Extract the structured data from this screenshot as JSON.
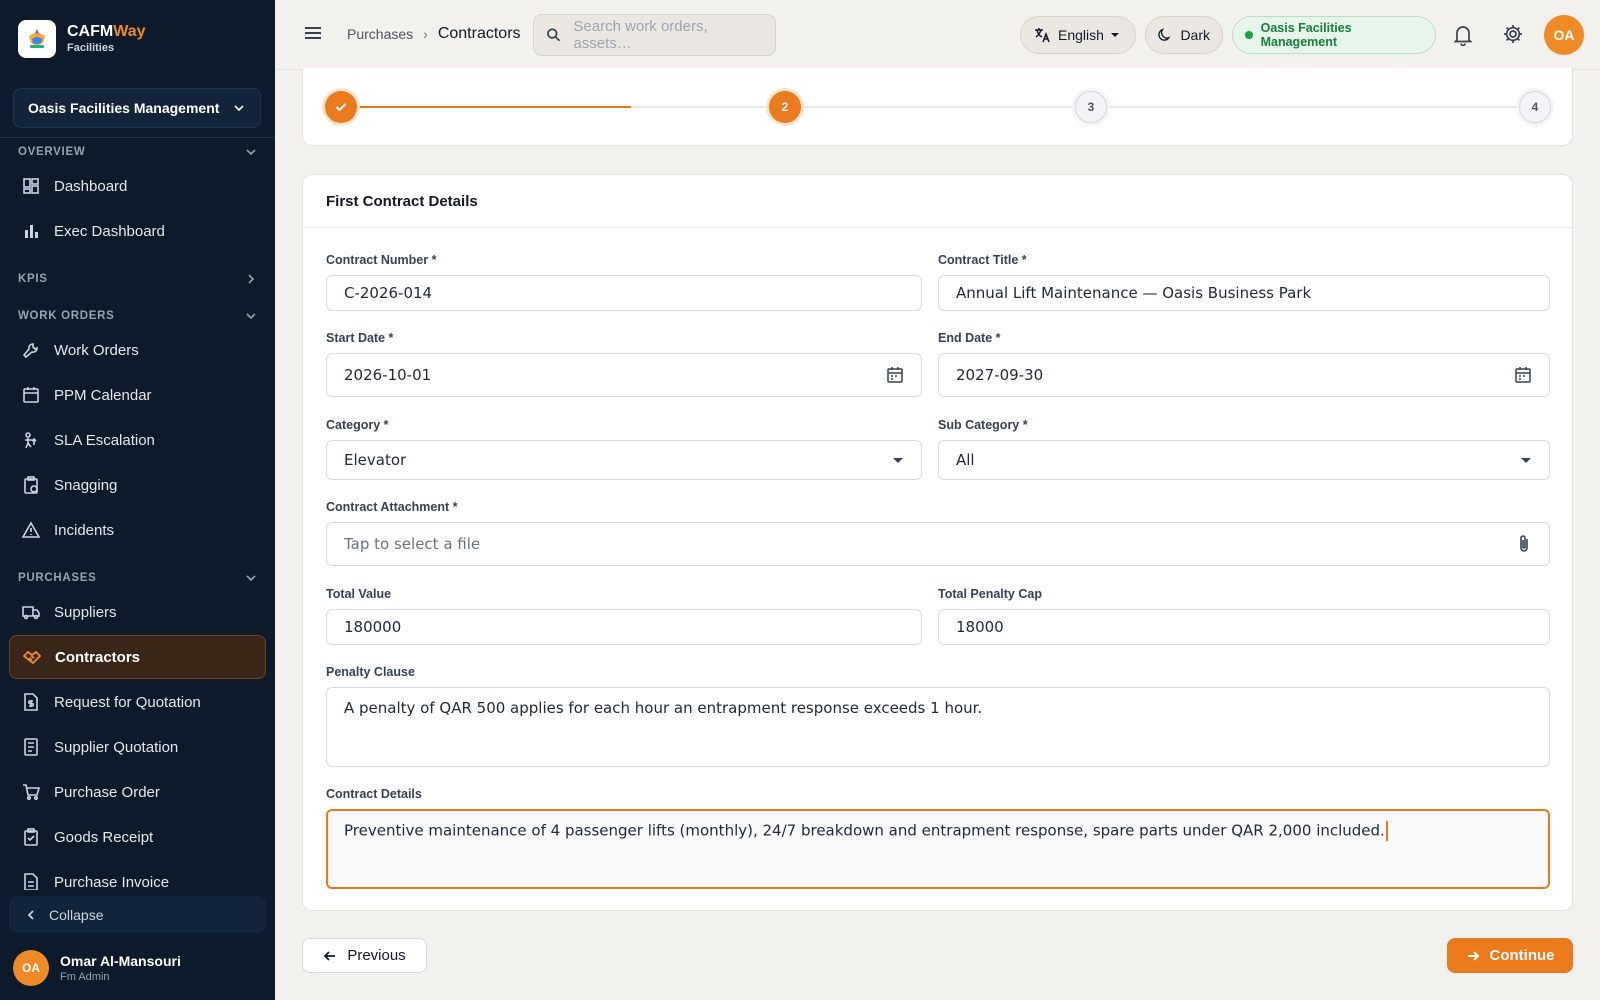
{
  "app": {
    "brand_main": "CAFM",
    "brand_accent": "Way",
    "brand_sub": "Facilities",
    "accent_color": "#ea7a1c",
    "sidebar_color": "#0c1a2b"
  },
  "sidebar": {
    "org": "Oasis Facilities Management",
    "sections": [
      {
        "title": "OVERVIEW",
        "items": [
          "Dashboard",
          "Exec Dashboard"
        ]
      },
      {
        "title": "KPIS",
        "items": []
      },
      {
        "title": "WORK ORDERS",
        "items": [
          "Work Orders",
          "PPM Calendar",
          "SLA Escalation",
          "Snagging",
          "Incidents"
        ]
      },
      {
        "title": "PURCHASES",
        "items": [
          "Suppliers",
          "Contractors",
          "Request for Quotation",
          "Supplier Quotation",
          "Purchase Order",
          "Goods Receipt",
          "Purchase Invoice"
        ]
      }
    ],
    "active_item": "Contractors",
    "collapse_label": "Collapse",
    "user": {
      "initials": "OA",
      "name": "Omar Al-Mansouri",
      "role": "Fm Admin"
    }
  },
  "topbar": {
    "breadcrumb": [
      "Purchases",
      "Contractors"
    ],
    "search_placeholder": "Search work orders, assets…",
    "language": "English",
    "theme_label": "Dark",
    "org_badge": "Oasis Facilities Management",
    "avatar_initials": "OA"
  },
  "stepper": {
    "steps": [
      "✓",
      "2",
      "3",
      "4"
    ],
    "current": 2
  },
  "form": {
    "title": "First Contract Details",
    "contract_number": {
      "label": "Contract Number *",
      "value": "C-2026-014"
    },
    "contract_title": {
      "label": "Contract Title *",
      "value": "Annual Lift Maintenance — Oasis Business Park"
    },
    "start_date": {
      "label": "Start Date *",
      "value": "2026-10-01"
    },
    "end_date": {
      "label": "End Date *",
      "value": "2027-09-30"
    },
    "category": {
      "label": "Category *",
      "value": "Elevator"
    },
    "sub_category": {
      "label": "Sub Category *",
      "value": "All"
    },
    "attachment": {
      "label": "Contract Attachment *",
      "placeholder": "Tap to select a file"
    },
    "total_value": {
      "label": "Total Value",
      "value": "180000"
    },
    "penalty_cap": {
      "label": "Total Penalty Cap",
      "value": "18000"
    },
    "penalty_clause": {
      "label": "Penalty Clause",
      "value": "A penalty of QAR 500 applies for each hour an entrapment response exceeds 1 hour."
    },
    "contract_details": {
      "label": "Contract Details",
      "value": "Preventive maintenance of 4 passenger lifts (monthly), 24/7 breakdown and entrapment response, spare parts under QAR 2,000 included."
    }
  },
  "actions": {
    "previous": "Previous",
    "continue": "Continue"
  }
}
